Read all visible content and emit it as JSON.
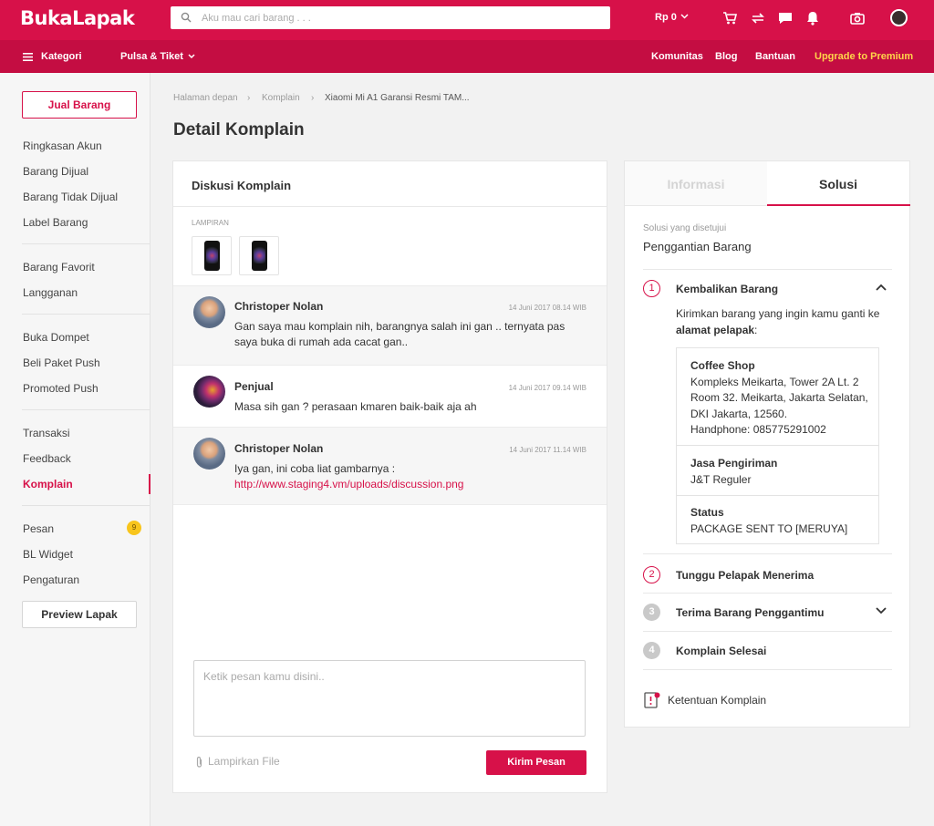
{
  "header": {
    "logo": "BukaLapak",
    "search_placeholder": "Aku mau cari barang . . .",
    "balance": "Rp 0"
  },
  "nav": {
    "kategori": "Kategori",
    "pulsa": "Pulsa & Tiket",
    "komunitas": "Komunitas",
    "blog": "Blog",
    "bantuan": "Bantuan",
    "premium": "Upgrade to Premium"
  },
  "sidebar": {
    "jual": "Jual Barang",
    "items": [
      "Ringkasan Akun",
      "Barang Dijual",
      "Barang Tidak Dijual",
      "Label Barang",
      "Barang Favorit",
      "Langganan",
      "Buka Dompet",
      "Beli Paket Push",
      "Promoted Push",
      "Transaksi",
      "Feedback",
      "Komplain",
      "Pesan",
      "BL Widget",
      "Pengaturan"
    ],
    "pesan_badge": "9",
    "preview": "Preview Lapak"
  },
  "breadcrumb": [
    "Halaman depan",
    "Komplain",
    "Xiaomi Mi A1 Garansi Resmi TAM..."
  ],
  "page_title": "Detail Komplain",
  "discussion": {
    "title": "Diskusi Komplain",
    "lampiran": "LAMPIRAN",
    "messages": [
      {
        "name": "Christoper Nolan",
        "time": "14 Juni 2017  08.14 WIB",
        "text": "Gan saya mau komplain nih, barangnya salah ini gan .. ternyata pas saya buka di rumah ada cacat gan.."
      },
      {
        "name": "Penjual",
        "time": "14 Juni 2017 09.14 WIB",
        "text": "Masa sih gan ?  perasaan kmaren baik-baik aja ah"
      },
      {
        "name": "Christoper Nolan",
        "time": "14 Juni 2017 11.14 WIB",
        "text": "Iya gan, ini coba liat gambarnya :",
        "link": "http://www.staging4.vm/uploads/discussion.png"
      }
    ],
    "compose_placeholder": "Ketik pesan kamu disini..",
    "attach": "Lampirkan File",
    "send": "Kirim Pesan"
  },
  "solution": {
    "tab_info": "Informasi",
    "tab_solusi": "Solusi",
    "agreed_label": "Solusi yang disetujui",
    "agreed_value": "Penggantian Barang",
    "steps": [
      {
        "num": "1",
        "label": "Kembalikan Barang"
      },
      {
        "num": "2",
        "label": "Tunggu Pelapak Menerima"
      },
      {
        "num": "3",
        "label": "Terima Barang Penggantimu"
      },
      {
        "num": "4",
        "label": "Komplain Selesai"
      }
    ],
    "desc_pre": "Kirimkan barang yang ingin kamu ganti ke ",
    "desc_bold": "alamat pelapak",
    "desc_post": ":",
    "address_title": "Coffee Shop",
    "address_body": "Kompleks Meikarta, Tower 2A Lt. 2 Room 32. Meikarta, Jakarta Selatan, DKI Jakarta, 12560.",
    "phone": "Handphone: 085775291002",
    "shipping_title": "Jasa Pengiriman",
    "shipping_value": "J&T Reguler",
    "status_title": "Status",
    "status_value": "PACKAGE SENT TO [MERUYA]",
    "ketentuan": "Ketentuan Komplain"
  },
  "colors": {
    "brand": "#d71149",
    "nav": "#c40d42",
    "premium": "#ffd54a",
    "badge": "#f8c51c"
  }
}
